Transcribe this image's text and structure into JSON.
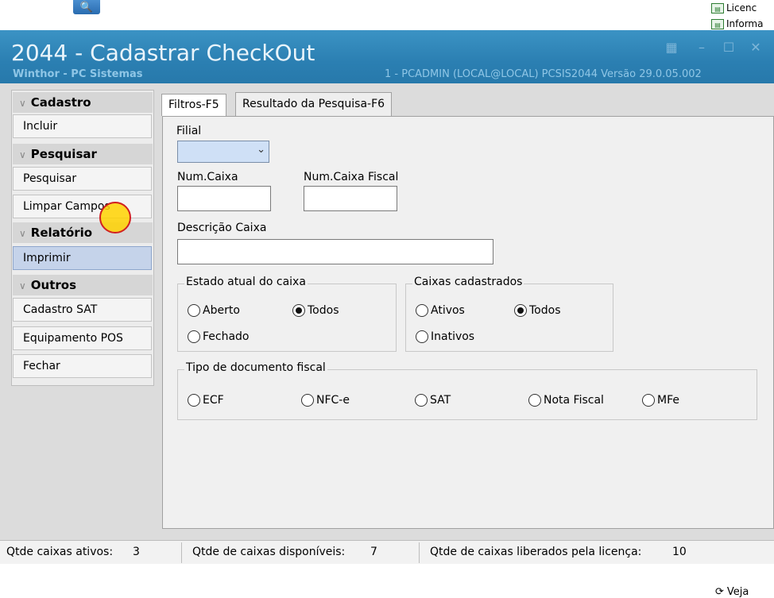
{
  "desktop": {
    "search_icon": "magnifier-icon",
    "links": [
      "Licenc",
      "Informa"
    ],
    "veja_label": "Veja"
  },
  "window": {
    "title": "2044 - Cadastrar CheckOut",
    "subtitle": "Winthor - PC Sistemas",
    "session": "1 - PCADMIN (LOCAL@LOCAL)   PCSIS2044  Versão  29.0.05.002"
  },
  "sidebar": {
    "groups": [
      {
        "label": "Cadastro",
        "items": [
          "Incluir"
        ]
      },
      {
        "label": "Pesquisar",
        "items": [
          "Pesquisar",
          "Limpar Campos"
        ]
      },
      {
        "label": "Relatório",
        "items": [
          "Imprimir"
        ]
      },
      {
        "label": "Outros",
        "items": [
          "Cadastro SAT",
          "Equipamento POS",
          "Fechar"
        ]
      }
    ]
  },
  "tabs": [
    "Filtros-F5",
    "Resultado da Pesquisa-F6"
  ],
  "filters": {
    "filial_label": "Filial",
    "filial_value": "",
    "num_caixa_label": "Num.Caixa",
    "num_caixa_fiscal_label": "Num.Caixa Fiscal",
    "descricao_label": "Descrição Caixa",
    "estado": {
      "legend": "Estado atual do caixa",
      "options": [
        "Aberto",
        "Todos",
        "Fechado"
      ],
      "selected": "Todos"
    },
    "caixas": {
      "legend": "Caixas cadastrados",
      "options": [
        "Ativos",
        "Todos",
        "Inativos"
      ],
      "selected": "Todos"
    },
    "tipo": {
      "legend": "Tipo de documento fiscal",
      "options": [
        "ECF",
        "NFC-e",
        "SAT",
        "Nota Fiscal",
        "MFe"
      ]
    }
  },
  "status": {
    "ativos_label": "Qtde caixas ativos:",
    "ativos_value": "3",
    "disponiveis_label": "Qtde de caixas disponíveis:",
    "disponiveis_value": "7",
    "liberados_label": "Qtde de caixas liberados pela licença:",
    "liberados_value": "10"
  }
}
